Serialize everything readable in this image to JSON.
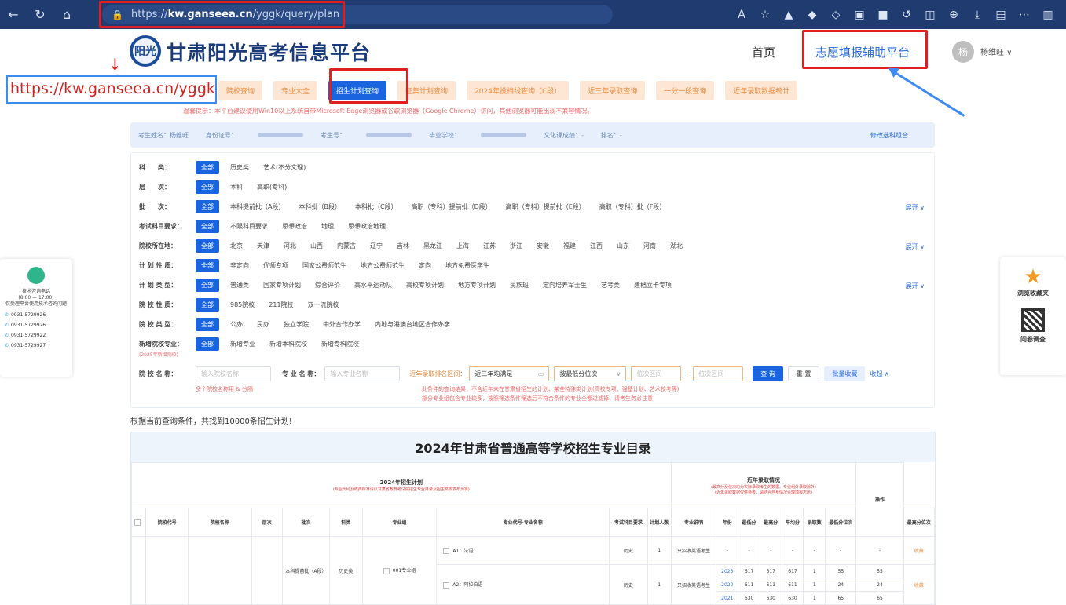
{
  "browser": {
    "url_prefix": "https://",
    "url_domain": "kw.ganseea.cn",
    "url_path": "/yggk/query/plan"
  },
  "header": {
    "logo_text": "阳光",
    "site_title": "甘肃阳光高考信息平台",
    "nav_home": "首页",
    "nav_volunteer": "志愿填报辅助平台",
    "avatar_char": "杨",
    "user_name": "杨维旺 ∨"
  },
  "callout_url": "https://kw.ganseea.cn/yggk",
  "tabs": [
    {
      "label": "院校查询"
    },
    {
      "label": "专业大全"
    },
    {
      "label": "招生计划查询"
    },
    {
      "label": "征集计划查询"
    },
    {
      "label": "2024年投档线查询（C段）"
    },
    {
      "label": "近三年录取查询"
    },
    {
      "label": "一分一段查询"
    },
    {
      "label": "近年录取数据统计"
    }
  ],
  "tip": "温馨提示：本平台建议使用Win10以上系统自带Microsoft Edge浏览器或谷歌浏览器（Google Chrome）访问，其他浏览器可能出现不兼容情况。",
  "infobar": {
    "name": "考生姓名：杨维旺",
    "id": "身份证号：",
    "exam_no": "考生号：",
    "school": "毕业学校：",
    "score": "文化课成绩：-",
    "rank": "排名：-",
    "modify": "修改选科组合"
  },
  "filters": [
    {
      "label": "科　　类：",
      "all": "全部",
      "options": [
        "历史类",
        "艺术(不分文理)"
      ]
    },
    {
      "label": "层　　次：",
      "all": "全部",
      "options": [
        "本科",
        "高职(专科)"
      ]
    },
    {
      "label": "批　　次：",
      "all": "全部",
      "options": [
        "本科提前批（A段）",
        "本科批（B段）",
        "本科批（C段）",
        "高职（专科）提前批（D段）",
        "高职（专科）提前批（E段）",
        "高职（专科）批（F段）"
      ],
      "more": "展开 ∨"
    },
    {
      "label": "考试科目要求：",
      "all": "全部",
      "options": [
        "不限科目要求",
        "思想政治",
        "地理",
        "思想政治地理"
      ]
    },
    {
      "label": "院校所在地：",
      "all": "全部",
      "options": [
        "北京",
        "天津",
        "河北",
        "山西",
        "内蒙古",
        "辽宁",
        "吉林",
        "黑龙江",
        "上海",
        "江苏",
        "浙江",
        "安徽",
        "福建",
        "江西",
        "山东",
        "河南",
        "湖北"
      ],
      "more": "展开 ∨"
    },
    {
      "label": "计 划 性 质：",
      "all": "全部",
      "options": [
        "非定向",
        "优师专项",
        "国家公费师范生",
        "地方公费师范生",
        "定向",
        "地方免费医学生"
      ]
    },
    {
      "label": "计 划 类 型：",
      "all": "全部",
      "options": [
        "普通类",
        "国家专项计划",
        "综合评价",
        "高水平运动队",
        "高校专项计划",
        "地方专项计划",
        "民族班",
        "定向培养军士生",
        "艺考类",
        "建档立卡专项"
      ],
      "more": "展开 ∨"
    },
    {
      "label": "院 校 性 质：",
      "all": "全部",
      "options": [
        "985院校",
        "211院校",
        "双一流院校"
      ]
    },
    {
      "label": "院 校 类 型：",
      "all": "全部",
      "options": [
        "公办",
        "民办",
        "独立学院",
        "中外合作办学",
        "内地与港澳台地区合作办学"
      ]
    },
    {
      "label": "新增院校专业：",
      "all": "全部",
      "options": [
        "新增专业",
        "新增本科院校",
        "新增专科院校"
      ]
    }
  ],
  "filter_new_note": "(2025年新增院校)",
  "search": {
    "school_label": "院 校 名 称：",
    "school_placeholder": "输入院校名称",
    "major_label": "专 业 名 称：",
    "major_placeholder": "输入专业名称",
    "range_label": "近年录取排名区间：",
    "range_value": "近三年均满足",
    "rank_select": "按最低分位次",
    "range_from": "位次区间",
    "range_to": "位次区间",
    "search_btn": "查 询",
    "reset_btn": "重 置",
    "batch_btn": "批量收藏",
    "collapse": "收起 ∧",
    "multi_hint": "多个院校名称用 & 分隔",
    "note1": "此条件的查询结果，不含近年未在甘肃省招生的计划、某些特殊类计划(高校专项、强基计划、艺术校考等)",
    "note2": "部分专业组包含专业较多，按照筛选条件筛选后不符合条件的专业全都过滤掉，请考生务必注意"
  },
  "sidebar_left": {
    "title": "技术咨询电话",
    "hours": "(8:00 — 17:00)",
    "desc": "仅受理平台使用技术咨询问题",
    "phones": [
      "0931-5729926",
      "0931-5729926",
      "0931-5729922",
      "0931-5729927"
    ]
  },
  "sidebar_right": {
    "fav_label": "浏览收藏夹",
    "survey_label": "问卷调查"
  },
  "result_text": "根据当前查询条件，共找到10000条招生计划!",
  "table": {
    "title": "2024年甘肃省普通高等学校招生专业目录",
    "plan_group": "2024年招生计划",
    "plan_sub": "(专业代码及收费标准请以甘肃省教育考试院招生专业目录及招生高校发布为准)",
    "history_group": "近年录取情况",
    "history_sub1": "(最高分及位次均为实际录取考生的数据。专业组外录取除外)",
    "history_sub2": "(近年录取数据仅供参考，请结合自身情况合理填报志愿)",
    "op": "操作",
    "headers": [
      "院校代号",
      "院校名称",
      "层次",
      "批次",
      "科类",
      "专业组",
      "专业代号·专业名称",
      "考试科目要求",
      "计划人数",
      "专业说明",
      "年份",
      "最低分",
      "最高分",
      "平均分",
      "录取数",
      "最低分位次",
      "最高分位次"
    ],
    "batch": "本科提前批（A段）",
    "category": "历史类",
    "group": "001专业组",
    "rows": [
      {
        "major": "A1：法语",
        "req": "历史",
        "count": "1",
        "desc": "只招收英语考生",
        "years": [
          {
            "year": "-",
            "min": "-",
            "max": "-",
            "avg": "-",
            "num": "-",
            "minr": "-",
            "maxr": "-"
          }
        ],
        "op": "收藏"
      },
      {
        "major": "A2：阿拉伯语",
        "req": "历史",
        "count": "1",
        "desc": "只招收英语考生",
        "years": [
          {
            "year": "2023",
            "min": "617",
            "max": "617",
            "avg": "617",
            "num": "1",
            "minr": "55",
            "maxr": "55"
          },
          {
            "year": "2022",
            "min": "611",
            "max": "611",
            "avg": "611",
            "num": "1",
            "minr": "24",
            "maxr": "24"
          },
          {
            "year": "2021",
            "min": "630",
            "max": "630",
            "avg": "630",
            "num": "1",
            "minr": "65",
            "maxr": "65"
          }
        ],
        "op": "收藏"
      }
    ]
  }
}
